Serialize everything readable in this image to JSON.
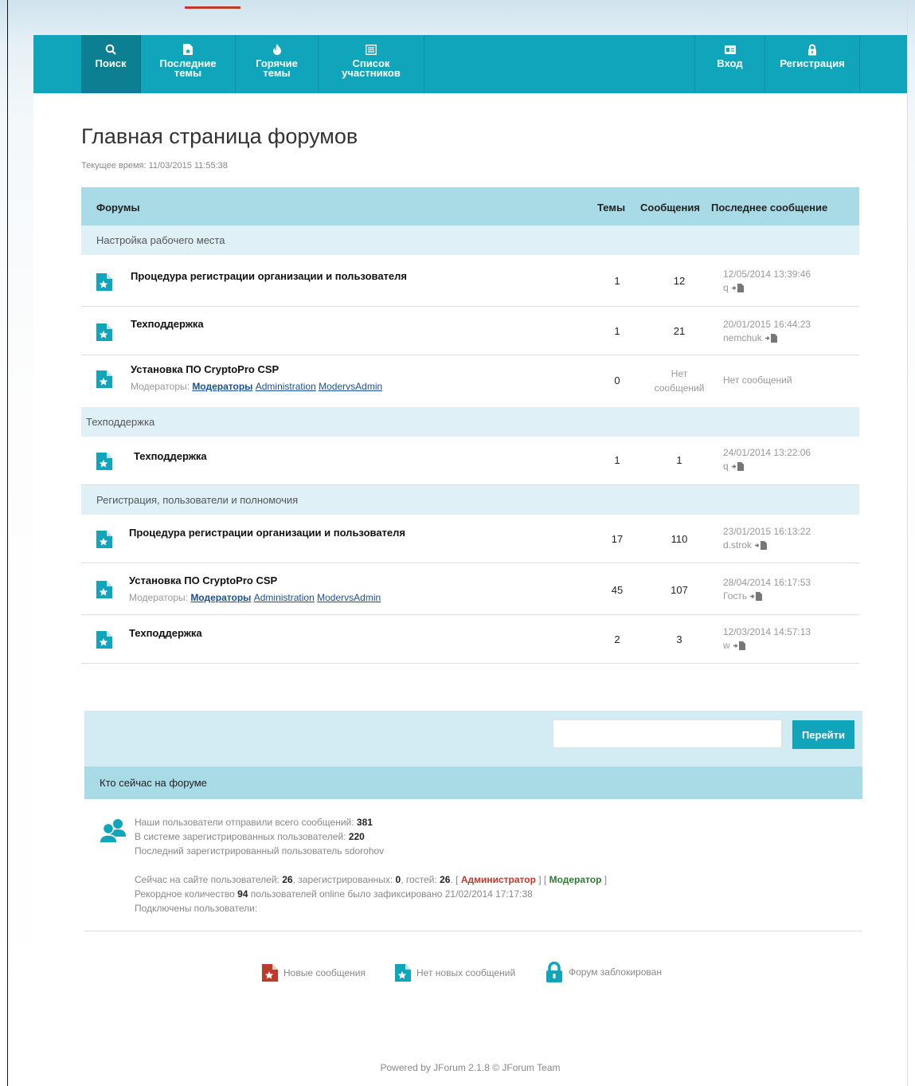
{
  "nav": {
    "left": [
      {
        "label": "Поиск",
        "icon": "search-icon"
      },
      {
        "label": "Последние\nтемы",
        "icon": "document-icon"
      },
      {
        "label": "Горячие\nтемы",
        "icon": "fire-icon"
      },
      {
        "label": "Список\nучастников",
        "icon": "list-icon"
      }
    ],
    "right": [
      {
        "label": "Вход",
        "icon": "id-card-icon"
      },
      {
        "label": "Регистрация",
        "icon": "lock-icon"
      }
    ]
  },
  "page": {
    "title": "Главная страница форумов",
    "current_time": "Текущее время: 11/03/2015 11:55:38"
  },
  "table": {
    "headers": {
      "forums": "Форумы",
      "topics": "Темы",
      "messages": "Сообщения",
      "last": "Последнее сообщение"
    },
    "categories": [
      {
        "name": "Настройка рабочего места",
        "forums": [
          {
            "name": "Процедура регистрации организации и пользователя",
            "topics": "1",
            "messages": "12",
            "last_date": "12/05/2014 13:39:46",
            "last_user": "q"
          },
          {
            "name": "Техподдержка",
            "topics": "1",
            "messages": "21",
            "last_date": "20/01/2015 16:44:23",
            "last_user": "nemchuk"
          },
          {
            "name": "Установка ПО CryptoPro CSP",
            "mods_label": "Модераторы:",
            "mods": [
              "Модераторы",
              "Administration",
              "ModervsAdmin"
            ],
            "topics": "0",
            "no_messages": "Нет сообщений",
            "last_none": "Нет сообщений"
          }
        ]
      },
      {
        "name": "Техподдержка",
        "forums": [
          {
            "name": "Техподдержка",
            "topics": "1",
            "messages": "1",
            "last_date": "24/01/2014 13:22:06",
            "last_user": "q"
          }
        ]
      },
      {
        "name": "Регистрация, пользователи и полномочия",
        "forums": [
          {
            "name": "Процедура регистрации организации и пользователя",
            "topics": "17",
            "messages": "110",
            "last_date": "23/01/2015 16:13:22",
            "last_user": "d.strok"
          },
          {
            "name": "Установка ПО CryptoPro CSP",
            "mods_label": "Модераторы:",
            "mods": [
              "Модераторы",
              "Administration",
              "ModervsAdmin"
            ],
            "topics": "45",
            "messages": "107",
            "last_date": "28/04/2014 16:17:53",
            "last_user": "Гость"
          },
          {
            "name": "Техподдержка",
            "topics": "2",
            "messages": "3",
            "last_date": "12/03/2014 14:57:13",
            "last_user": "w"
          }
        ]
      }
    ]
  },
  "jump": {
    "input_value": "",
    "button": "Перейти"
  },
  "who": {
    "title": "Кто сейчас на форуме",
    "stats1": {
      "pre": "Наши пользователи отправили всего сообщений: ",
      "val": "381"
    },
    "stats2": {
      "pre": "В системе зарегистрированных пользователей: ",
      "val": "220"
    },
    "stats3": "Последний зарегистрированный пользователь sdorohov",
    "online": {
      "pre": "Сейчас на сайте пользователей: ",
      "total": "26",
      "mid1": ", зарегистрированных: ",
      "registered": "0",
      "mid2": ", гостей: ",
      "guests": "26",
      "mid3": ". [ ",
      "admin": "Администратор",
      "mid4": " ] [ ",
      "moder": "Модератор",
      "post": " ]"
    },
    "record": {
      "pre": "Рекордное количество ",
      "val": "94",
      "post": " пользователей online было зафиксировано 21/02/2014 17:17:38"
    },
    "connected": "Подключены пользователи:"
  },
  "legend": {
    "new": "Новые сообщения",
    "no_new": "Нет новых сообщений",
    "locked": "Форум заблокирован"
  },
  "footer": "Powered by JForum 2.1.8 © JForum Team",
  "colors": {
    "accent": "#11a5bb",
    "accent_dark": "#0c7f92",
    "header_bg": "#a9dbe6",
    "category_bg": "#dff0f6",
    "red": "#c0392b"
  }
}
